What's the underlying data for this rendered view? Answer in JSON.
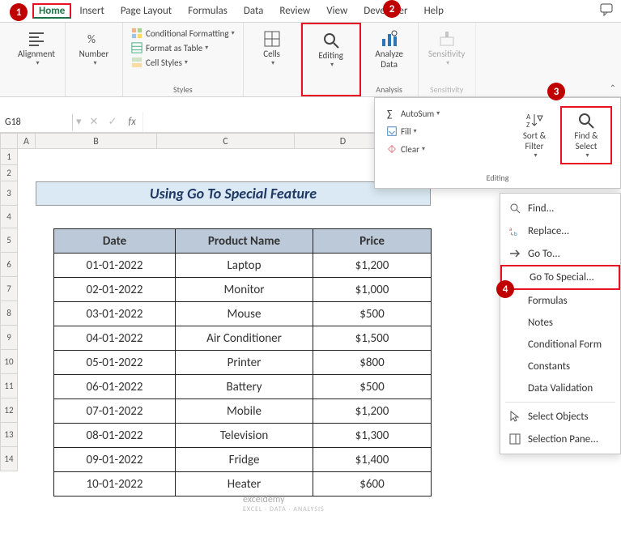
{
  "callouts": {
    "c1": "1",
    "c2": "2",
    "c3": "3",
    "c4": "4"
  },
  "tabs": {
    "home": "Home",
    "insert": "Insert",
    "pageLayout": "Page Layout",
    "formulas": "Formulas",
    "data": "Data",
    "review": "Review",
    "view": "View",
    "developer": "Developer",
    "help": "Help"
  },
  "ribbon": {
    "alignment": {
      "label": "Alignment",
      "group": ""
    },
    "number": {
      "label": "Number",
      "group": ""
    },
    "styles": {
      "cond": "Conditional Formatting",
      "table": "Format as Table",
      "cell": "Cell Styles",
      "group": "Styles"
    },
    "cells": {
      "label": "Cells"
    },
    "editing": {
      "label": "Editing"
    },
    "analyze": {
      "label": "Analyze",
      "sub": "Data",
      "group": "Analysis"
    },
    "sensitivity": {
      "label": "Sensitivity",
      "group": "Sensitivity"
    }
  },
  "fbar": {
    "namebox": "G18",
    "fx": "fx"
  },
  "cols": {
    "A": "A",
    "B": "B",
    "C": "C",
    "D": "D"
  },
  "title": "Using Go To Special Feature",
  "headers": {
    "date": "Date",
    "product": "Product Name",
    "price": "Price"
  },
  "chart_data": {
    "type": "table",
    "columns": [
      "Date",
      "Product Name",
      "Price"
    ],
    "rows": [
      {
        "date": "01-01-2022",
        "product": "Laptop",
        "price": "$1,200"
      },
      {
        "date": "02-01-2022",
        "product": "Monitor",
        "price": "$1,000"
      },
      {
        "date": "03-01-2022",
        "product": "Mouse",
        "price": "$500"
      },
      {
        "date": "04-01-2022",
        "product": "Air Conditioner",
        "price": "$1,500"
      },
      {
        "date": "05-01-2022",
        "product": "Printer",
        "price": "$800"
      },
      {
        "date": "06-01-2022",
        "product": "Battery",
        "price": "$500"
      },
      {
        "date": "07-01-2022",
        "product": "Mobile",
        "price": "$1,200"
      },
      {
        "date": "08-01-2022",
        "product": "Television",
        "price": "$1,300"
      },
      {
        "date": "09-01-2022",
        "product": "Fridge",
        "price": "$1,400"
      },
      {
        "date": "10-01-2022",
        "product": "Heater",
        "price": "$600"
      }
    ]
  },
  "panel": {
    "autosum": "AutoSum",
    "fill": "Fill",
    "clear": "Clear",
    "sortfilter": "Sort &",
    "sortfilter2": "Filter",
    "findselect": "Find &",
    "findselect2": "Select",
    "group": "Editing"
  },
  "submenu": {
    "find": "Find...",
    "replace": "Replace...",
    "goto": "Go To...",
    "gotospecial": "Go To Special...",
    "formulas": "Formulas",
    "notes": "Notes",
    "condfmt": "Conditional Form",
    "constants": "Constants",
    "datavalid": "Data Validation",
    "selectobj": "Select Objects",
    "selpane": "Selection Pane..."
  },
  "watermark": {
    "t": "exceldemy",
    "s": "EXCEL · DATA · ANALYSIS"
  }
}
